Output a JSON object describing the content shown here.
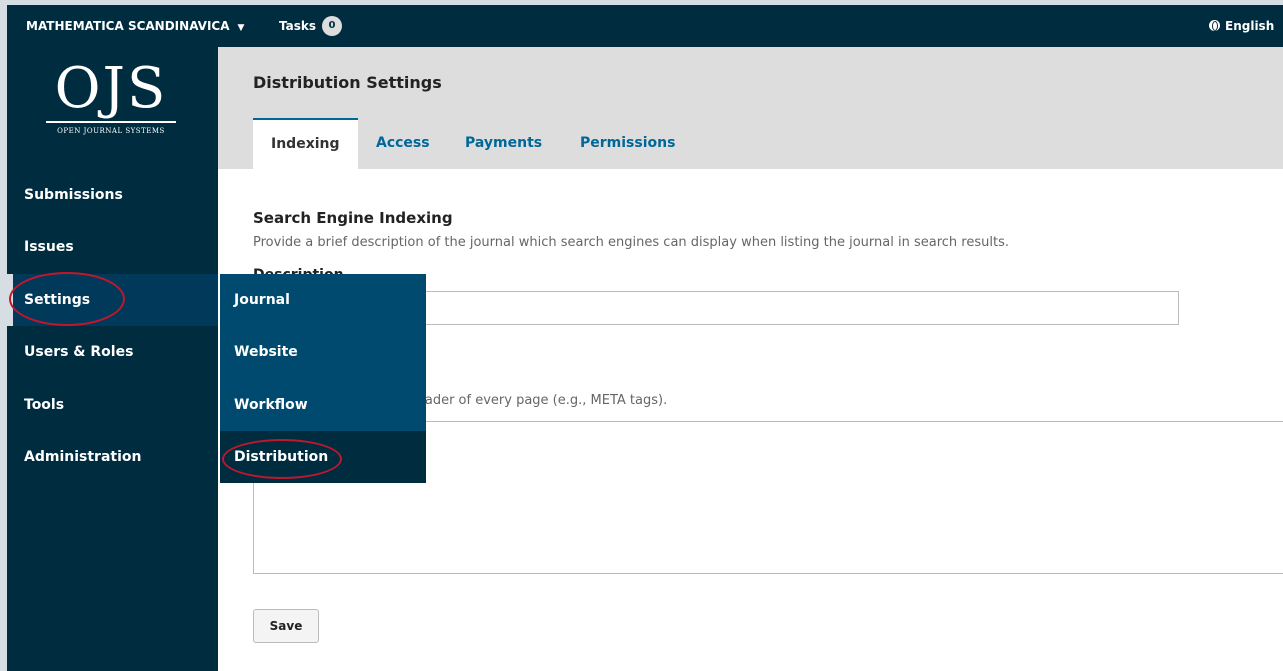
{
  "topbar": {
    "journal_name": "MATHEMATICA SCANDINAVICA",
    "tasks_label": "Tasks",
    "tasks_count": "0",
    "language": "English"
  },
  "logo": {
    "mark": "OJS",
    "subtitle": "OPEN JOURNAL SYSTEMS"
  },
  "sidebar": {
    "items": [
      {
        "label": "Submissions"
      },
      {
        "label": "Issues"
      },
      {
        "label": "Settings"
      },
      {
        "label": "Users & Roles"
      },
      {
        "label": "Tools"
      },
      {
        "label": "Administration"
      }
    ]
  },
  "submenu": {
    "items": [
      {
        "label": "Journal"
      },
      {
        "label": "Website"
      },
      {
        "label": "Workflow"
      },
      {
        "label": "Distribution"
      }
    ]
  },
  "header": {
    "title": "Distribution Settings",
    "tabs": [
      {
        "label": "Indexing"
      },
      {
        "label": "Access"
      },
      {
        "label": "Payments"
      },
      {
        "label": "Permissions"
      }
    ]
  },
  "form": {
    "section_title": "Search Engine Indexing",
    "section_description": "Provide a brief description of the journal which search engines can display when listing the journal in search results.",
    "description_label": "Description",
    "description_value": "",
    "headers_description_partial": "gs to be inserted in the header of every page (e.g., META tags).",
    "headers_value": "",
    "save_label": "Save"
  },
  "colors": {
    "nav_dark": "#002c40",
    "submenu": "#004a6f",
    "link_blue": "#006798",
    "annotation_red": "#c0172c"
  }
}
